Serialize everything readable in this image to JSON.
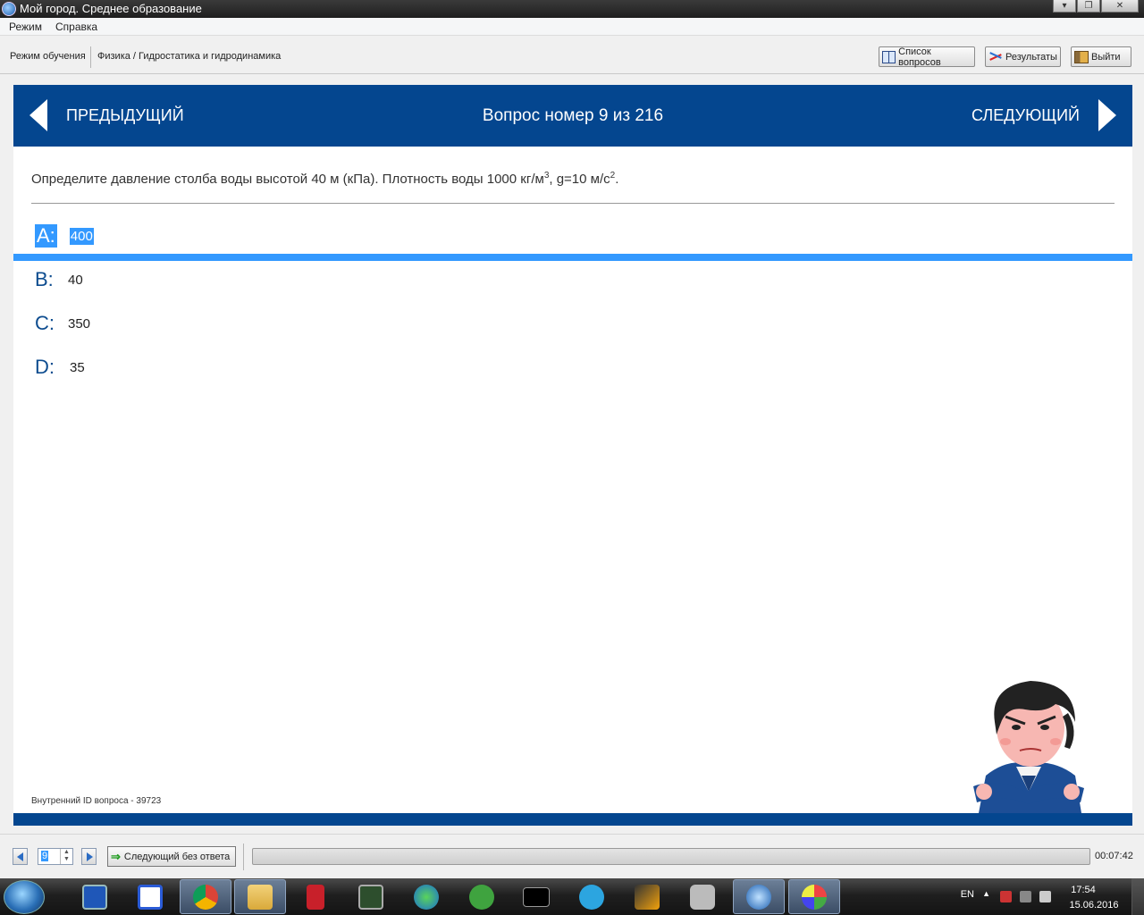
{
  "window": {
    "title": "Мой город. Среднее образование"
  },
  "menu": {
    "items": [
      "Режим",
      "Справка"
    ]
  },
  "toolbar": {
    "mode": "Режим обучения",
    "subject": "Физика / Гидростатика и гидродинамика",
    "questions_list": "Список вопросов",
    "results": "Результаты",
    "exit": "Выйти"
  },
  "nav": {
    "prev": "ПРЕДЫДУЩИЙ",
    "next": "СЛЕДУЮЩИЙ",
    "question_number": "Вопрос номер 9 из 216"
  },
  "question": {
    "text_a": "Определите давление столба воды высотой 40 м (кПа). Плотность воды 1000 кг/м",
    "sup_a": "3",
    "text_b": ", g=10 м/с",
    "sup_b": "2",
    "text_c": "."
  },
  "answers": [
    {
      "letter": "A:",
      "value": "400",
      "selected": true
    },
    {
      "letter": "B:",
      "value": "40",
      "selected": false
    },
    {
      "letter": "C:",
      "value": "350",
      "selected": false
    },
    {
      "letter": "D:",
      "value": "35",
      "selected": false
    }
  ],
  "internal_id": "Внутренний ID вопроса - 39723",
  "bottom": {
    "spin_value": "9",
    "skip": "Следующий без ответа",
    "timer": "00:07:42"
  },
  "taskbar": {
    "lang": "EN",
    "time": "17:54",
    "date": "15.06.2016"
  },
  "colors": {
    "brand": "#04468f",
    "selection": "#3399ff"
  }
}
